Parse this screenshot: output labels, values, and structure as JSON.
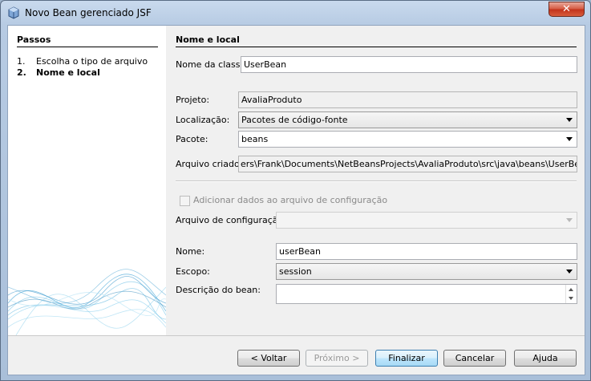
{
  "window": {
    "title": "Novo Bean gerenciado JSF",
    "close": "✕"
  },
  "steps": {
    "title": "Passos",
    "items": [
      {
        "num": "1.",
        "label": "Escolha o tipo de arquivo"
      },
      {
        "num": "2.",
        "label": "Nome e local"
      }
    ]
  },
  "form": {
    "section_title": "Nome e local",
    "class_name_label": "Nome da classe:",
    "class_name_value": "UserBean",
    "project_label": "Projeto:",
    "project_value": "AvaliaProduto",
    "location_label": "Localização:",
    "location_value": "Pacotes de código-fonte",
    "package_label": "Pacote:",
    "package_value": "beans",
    "created_file_label": "Arquivo criado:",
    "created_file_value": "ers\\Frank\\Documents\\NetBeansProjects\\AvaliaProduto\\src\\java\\beans\\UserBean.java",
    "add_config_label": "Adicionar dados ao arquivo de configuração",
    "config_file_label": "Arquivo de configuração:",
    "config_file_value": "",
    "name_label": "Nome:",
    "name_value": "userBean",
    "scope_label": "Escopo:",
    "scope_value": "session",
    "description_label": "Descrição do bean:",
    "description_value": ""
  },
  "buttons": {
    "back": "< Voltar",
    "next": "Próximo >",
    "finish": "Finalizar",
    "cancel": "Cancelar",
    "help": "Ajuda"
  }
}
